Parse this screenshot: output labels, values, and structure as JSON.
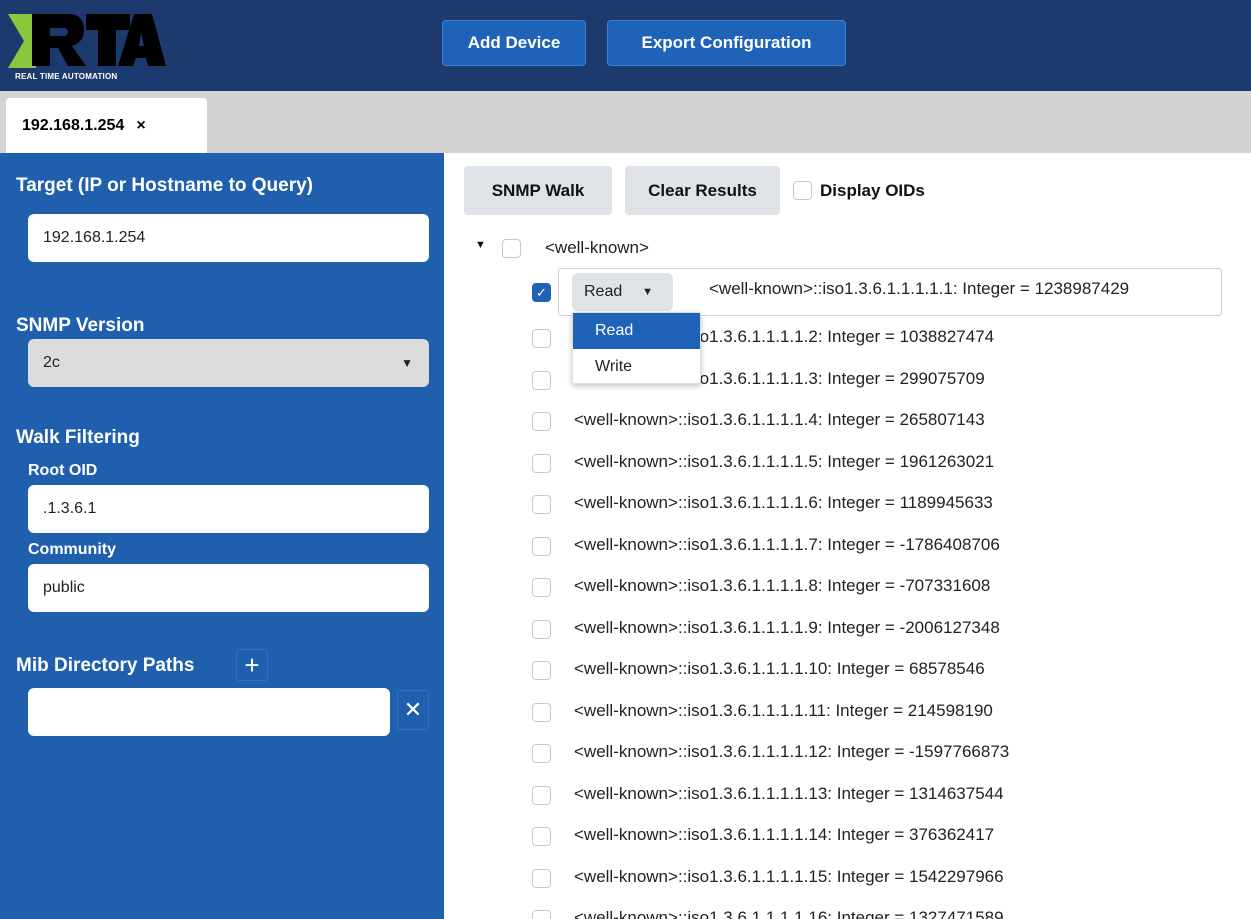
{
  "header": {
    "logo_text": "RTA",
    "logo_subtext": "REAL TIME AUTOMATION",
    "add_device_label": "Add Device",
    "export_label": "Export Configuration"
  },
  "tabs": [
    {
      "label": "192.168.1.254",
      "close": "×"
    }
  ],
  "sidebar": {
    "target_heading": "Target (IP or Hostname to Query)",
    "target_value": "192.168.1.254",
    "version_heading": "SNMP Version",
    "version_value": "2c",
    "walk_heading": "Walk Filtering",
    "root_oid_label": "Root OID",
    "root_oid_value": ".1.3.6.1",
    "community_label": "Community",
    "community_value": "public",
    "mib_heading": "Mib Directory Paths",
    "mib_value": ""
  },
  "toolbar": {
    "walk_label": "SNMP Walk",
    "clear_label": "Clear Results",
    "display_oids_label": "Display OIDs"
  },
  "tree": {
    "root_label": "<well-known>",
    "selected_row": {
      "access": "Read",
      "text": "<well-known>::iso1.3.6.1.1.1.1.1: Integer = 1238987429"
    },
    "dropdown_options": [
      "Read",
      "Write"
    ],
    "rows": [
      "<well-known>::iso1.3.6.1.1.1.1.2: Integer = 1038827474",
      "<well-known>::iso1.3.6.1.1.1.1.3: Integer = 299075709",
      "<well-known>::iso1.3.6.1.1.1.1.4: Integer = 265807143",
      "<well-known>::iso1.3.6.1.1.1.1.5: Integer = 1961263021",
      "<well-known>::iso1.3.6.1.1.1.1.6: Integer = 1189945633",
      "<well-known>::iso1.3.6.1.1.1.1.7: Integer = -1786408706",
      "<well-known>::iso1.3.6.1.1.1.1.8: Integer = -707331608",
      "<well-known>::iso1.3.6.1.1.1.1.9: Integer = -2006127348",
      "<well-known>::iso1.3.6.1.1.1.1.10: Integer = 68578546",
      "<well-known>::iso1.3.6.1.1.1.1.11: Integer = 214598190",
      "<well-known>::iso1.3.6.1.1.1.1.12: Integer = -1597766873",
      "<well-known>::iso1.3.6.1.1.1.1.13: Integer = 1314637544",
      "<well-known>::iso1.3.6.1.1.1.1.14: Integer = 376362417",
      "<well-known>::iso1.3.6.1.1.1.1.15: Integer = 1542297966",
      "<well-known>::iso1.3.6.1.1.1.1.16: Integer = 1327471589"
    ]
  }
}
